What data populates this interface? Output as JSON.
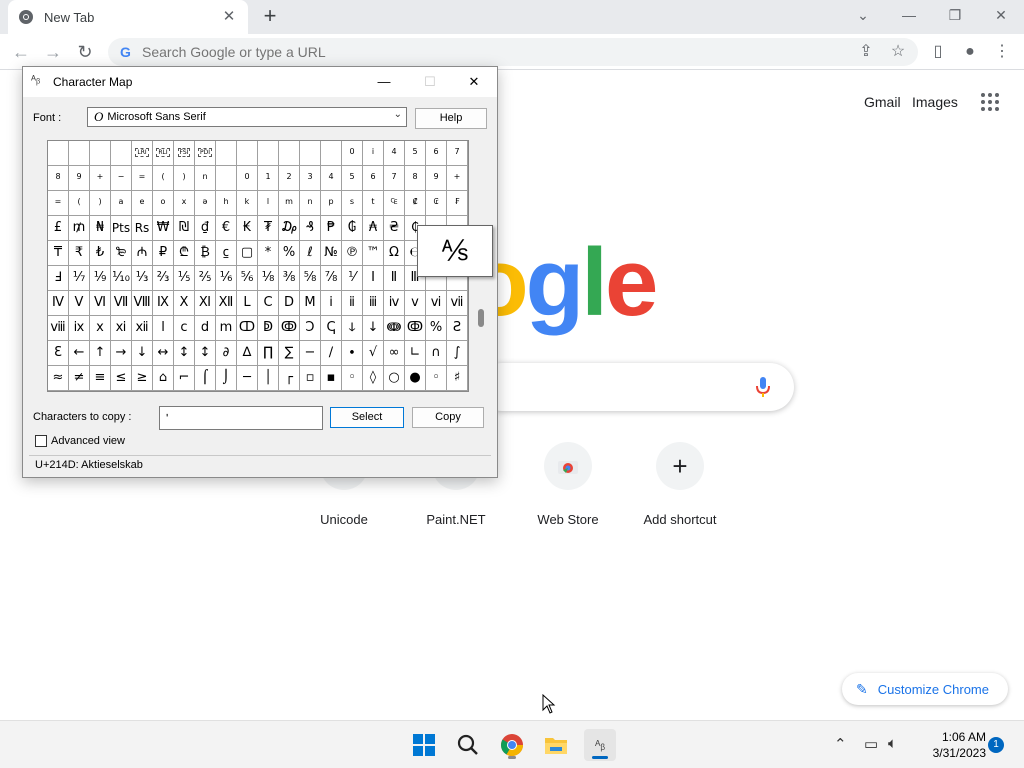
{
  "browser": {
    "tab_title": "New Tab",
    "omnibox_placeholder": "Search Google or type a URL"
  },
  "ntp": {
    "gmail": "Gmail",
    "images": "Images",
    "logo_visible": "ogle",
    "shortcuts": [
      {
        "label": "Unicode"
      },
      {
        "label": "Paint.NET"
      },
      {
        "label": "Web Store"
      },
      {
        "label": "Add shortcut"
      }
    ],
    "customize": "Customize Chrome"
  },
  "charmap": {
    "title": "Character Map",
    "font_label": "Font :",
    "font_value": "Microsoft Sans Serif",
    "help": "Help",
    "grid": [
      [
        "",
        "",
        "",
        "",
        "",
        "",
        "",
        "",
        "",
        "",
        "",
        "",
        "",
        "",
        "",
        "0",
        "i",
        "4",
        "5",
        "6",
        "7"
      ],
      [
        "8",
        "9",
        "+",
        "−",
        "=",
        "(",
        ")",
        "n",
        "",
        "0",
        "1",
        "2",
        "3",
        "4",
        "5",
        "6",
        "7",
        "8",
        "9",
        "+",
        "−"
      ],
      [
        "=",
        "(",
        ")",
        "a",
        "e",
        "o",
        "x",
        "ə",
        "h",
        "k",
        "l",
        "m",
        "n",
        "p",
        "s",
        "t",
        "₠",
        "₡",
        "₢",
        "₣"
      ],
      [
        "£",
        "₥",
        "₦",
        "Pts",
        "Rs",
        "₩",
        "₪",
        "₫",
        "€",
        "₭",
        "₮",
        "₯",
        "₰",
        "₱",
        "₲",
        "₳",
        "₴",
        "₵",
        "",
        ""
      ],
      [
        "₸",
        "₹",
        "₺",
        "₻",
        "₼",
        "₽",
        "₾",
        "₿",
        "⃀",
        "▢",
        "*",
        "%",
        "ℓ",
        "№",
        "℗",
        "™",
        "Ω",
        "℮",
        "",
        ""
      ],
      [
        "Ⅎ",
        "⅐",
        "⅑",
        "⅒",
        "⅓",
        "⅔",
        "⅕",
        "⅖",
        "⅙",
        "⅚",
        "⅛",
        "⅜",
        "⅝",
        "⅞",
        "⅟",
        "Ⅰ",
        "Ⅱ",
        "Ⅲ",
        "",
        ""
      ],
      [
        "Ⅳ",
        "Ⅴ",
        "Ⅵ",
        "Ⅶ",
        "Ⅷ",
        "Ⅸ",
        "Ⅹ",
        "Ⅺ",
        "Ⅻ",
        "Ⅼ",
        "Ⅽ",
        "Ⅾ",
        "Ⅿ",
        "ⅰ",
        "ⅱ",
        "ⅲ",
        "ⅳ",
        "ⅴ",
        "ⅵ",
        "ⅶ"
      ],
      [
        "ⅷ",
        "ⅸ",
        "ⅹ",
        "ⅺ",
        "ⅻ",
        "ⅼ",
        "ⅽ",
        "ⅾ",
        "ⅿ",
        "ↀ",
        "ↁ",
        "ↂ",
        "Ↄ",
        "ↅ",
        "ↆ",
        "↓",
        "ↈ",
        "ↂ",
        "%",
        "Ꙅ"
      ],
      [
        "Ɛ",
        "←",
        "↑",
        "→",
        "↓",
        "↔",
        "↕",
        "↕",
        "∂",
        "∆",
        "∏",
        "∑",
        "−",
        "∕",
        "∙",
        "√",
        "∞",
        "∟",
        "∩",
        "∫"
      ],
      [
        "≈",
        "≠",
        "≡",
        "≤",
        "≥",
        "⌂",
        "⌐",
        "⌠",
        "⌡",
        "─",
        "│",
        "┌",
        "▫",
        "▪",
        "◦",
        "◊",
        "○",
        "●",
        "◦",
        "♯"
      ]
    ],
    "boxed_labels": [
      "LRI",
      "RLI",
      "FSI",
      "PDI"
    ],
    "zoom_char": "⅍",
    "copy_label": "Characters to copy :",
    "copy_value": "ʹ",
    "select": "Select",
    "copy": "Copy",
    "advanced": "Advanced view",
    "status": "U+214D: Aktieselskab"
  },
  "taskbar": {
    "time": "1:06 AM",
    "date": "3/31/2023",
    "notifications": "1"
  }
}
